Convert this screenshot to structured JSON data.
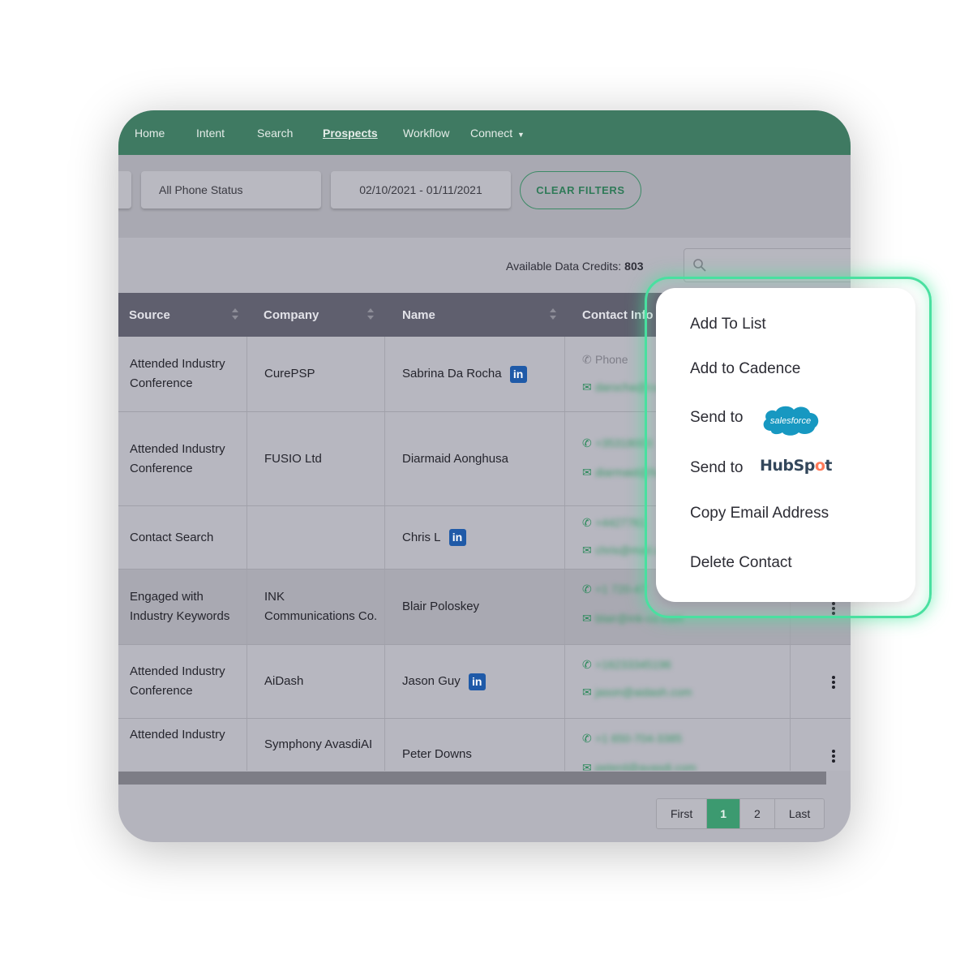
{
  "nav": {
    "items": [
      "Home",
      "Intent",
      "Search",
      "Prospects",
      "Workflow",
      "Connect"
    ],
    "active": "Prospects"
  },
  "filters": {
    "phone_status": "All Phone Status",
    "date_range": "02/10/2021 - 01/11/2021",
    "clear_label": "CLEAR FILTERS"
  },
  "credits": {
    "label": "Available Data Credits:",
    "value": "803"
  },
  "table": {
    "columns": [
      "Source",
      "Company",
      "Name",
      "Contact Info"
    ],
    "rows": [
      {
        "source": "Attended Industry Conference",
        "company": "CurePSP",
        "name": "Sabrina Da Rocha",
        "linkedin": true,
        "phone": "Phone",
        "email": "darocha@curepsp.org"
      },
      {
        "source": "Attended Industry Conference",
        "company": "FUSIO Ltd",
        "name": "Diarmaid Aonghusa",
        "linkedin": false,
        "phone": "+35318003",
        "email": "diarmaid@fusio.net"
      },
      {
        "source": "Contact Search",
        "company": "",
        "name": "Chris L",
        "linkedin": true,
        "phone": "+4427761",
        "email": "chris@mail.com"
      },
      {
        "source": "Engaged with Industry Keywords",
        "company": "INK Communications Co.",
        "name": "Blair Poloskey",
        "linkedin": false,
        "phone": "+1 720-47",
        "email": "blair@ink-co.com"
      },
      {
        "source": "Attended Industry Conference",
        "company": "AiDash",
        "name": "Jason Guy",
        "linkedin": true,
        "phone": "+16233345196",
        "email": "jason@aidash.com"
      },
      {
        "source": "Attended Industry",
        "company": "Symphony AvasdiAI",
        "name": "Peter Downs",
        "linkedin": false,
        "phone": "+1 650-704-3385",
        "email": "peterd@avasdi.com"
      }
    ]
  },
  "pagination": {
    "first": "First",
    "pages": [
      "1",
      "2"
    ],
    "current": "1",
    "last": "Last"
  },
  "context_menu": {
    "items": [
      "Add To List",
      "Add to Cadence",
      "Send to",
      "Send to",
      "Copy Email Address",
      "Delete Contact"
    ],
    "salesforce_logo_text": "salesforce",
    "hubspot_logo_text": "HubSpot"
  },
  "colors": {
    "nav_green": "#3f7a62",
    "accent_green": "#3c9a70",
    "glow": "#49e0a0",
    "linkedin_blue": "#1f5aa8"
  }
}
